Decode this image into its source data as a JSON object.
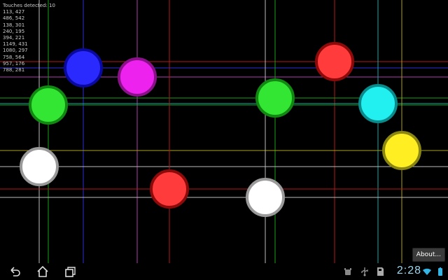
{
  "touch_readout": {
    "header": "Touches detected: 10",
    "coords": [
      "113, 427",
      "486, 542",
      "138, 301",
      "240, 195",
      "394, 221",
      "1149, 431",
      "1080, 297",
      "758, 564",
      "957, 176",
      "788, 281"
    ]
  },
  "about_button": {
    "label": "About..."
  },
  "status_bar": {
    "time": "2:28"
  },
  "colors": {
    "blue": "#2a2aff",
    "magenta": "#ee22ee",
    "red": "#ff3b3b",
    "green": "#33e633",
    "cyan": "#22f0f0",
    "yellow": "#ffee22",
    "white": "#ffffff"
  },
  "icons": {
    "nav_bar": [
      "back-icon",
      "home-icon",
      "recent-apps-icon"
    ],
    "status_bar": [
      "android-debug-icon",
      "usb-icon",
      "sd-card-icon",
      "wifi-icon",
      "battery-icon"
    ]
  }
}
